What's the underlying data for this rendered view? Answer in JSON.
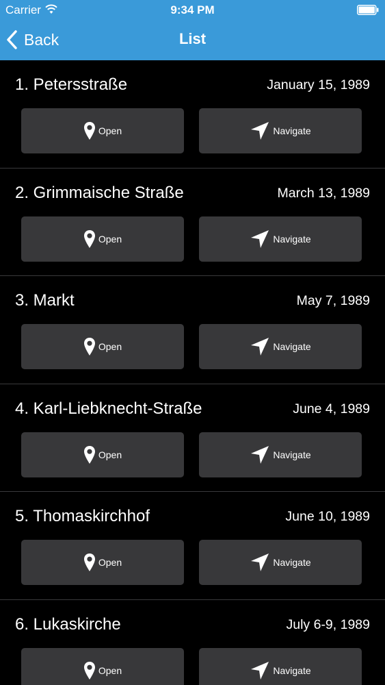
{
  "status_bar": {
    "carrier": "Carrier",
    "time": "9:34 PM"
  },
  "nav": {
    "back_label": "Back",
    "title": "List"
  },
  "colors": {
    "header": "#3a9ad9",
    "background": "#000000",
    "button": "#38383a"
  },
  "items": [
    {
      "title": "1. Petersstraße",
      "date": "January 15, 1989",
      "open_label": "Open",
      "navigate_label": "Navigate"
    },
    {
      "title": "2. Grimmaische Straße",
      "date": "March 13, 1989",
      "open_label": "Open",
      "navigate_label": "Navigate"
    },
    {
      "title": "3. Markt",
      "date": "May 7, 1989",
      "open_label": "Open",
      "navigate_label": "Navigate"
    },
    {
      "title": "4. Karl-Liebknecht-Straße",
      "date": "June 4, 1989",
      "open_label": "Open",
      "navigate_label": "Navigate"
    },
    {
      "title": "5. Thomaskirchhof",
      "date": "June 10, 1989",
      "open_label": "Open",
      "navigate_label": "Navigate"
    },
    {
      "title": "6. Lukaskirche",
      "date": "July 6-9, 1989",
      "open_label": "Open",
      "navigate_label": "Navigate"
    }
  ]
}
